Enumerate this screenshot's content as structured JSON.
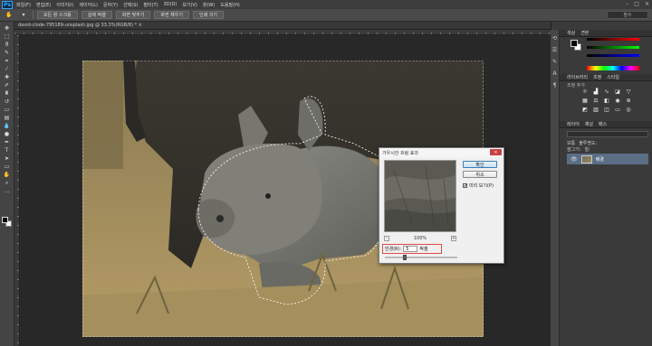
{
  "app": {
    "logo": "Ps"
  },
  "menubar": {
    "items": [
      "파일(F)",
      "편집(E)",
      "이미지(I)",
      "레이어(L)",
      "문자(Y)",
      "선택(S)",
      "필터(T)",
      "3D(D)",
      "보기(V)",
      "창(W)",
      "도움말(H)"
    ],
    "window_controls": [
      "–",
      "□",
      "✕"
    ]
  },
  "options_bar": {
    "buttons": [
      "모든 창 스크롤",
      "실제 픽셀",
      "화면 맞추기",
      "화면 채우기",
      "인쇄 크기"
    ],
    "workspace": "필수"
  },
  "document": {
    "tab_label": "david-clode-795189-unsplash.jpg @ 33.3%(RGB/8) * ×"
  },
  "dialog": {
    "title": "가우시안 흐림 효과",
    "close": "✕",
    "ok_label": "확인",
    "cancel_label": "취소",
    "preview_label": "미리 보기(P)",
    "preview_checked": "✔",
    "zoom_minus": "–",
    "zoom_value": "100%",
    "zoom_plus": "+",
    "radius_label": "반경(R):",
    "radius_value": "5",
    "radius_unit": "픽셀",
    "slider_value": 0.28
  },
  "panels": {
    "color_tabs": [
      "색상",
      "견본"
    ],
    "adjust_tabs": [
      "라이브러리",
      "조정",
      "스타일"
    ],
    "adjust_hint": "조정 추가",
    "layers_tabs": [
      "레이어",
      "채널",
      "패스"
    ],
    "blend_mode": "보통",
    "opacity": "불투명도:",
    "fill": "칠:",
    "lock": "잠그기:",
    "layer_name": "배경"
  },
  "colors": {
    "accent": "#31a8ff",
    "selected_layer": "#5a6e86",
    "close_button": "#c84141",
    "highlight_box": "#e04a4a"
  }
}
